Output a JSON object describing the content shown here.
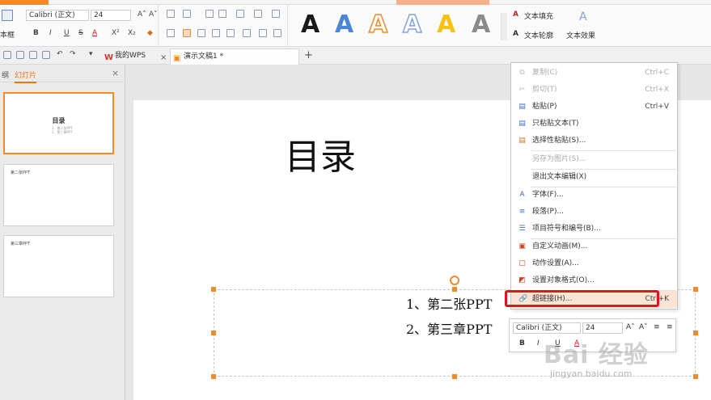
{
  "ribbon": {
    "textbox_label": "本框",
    "font_name": "Calibri (正文)",
    "font_size": "24",
    "bold": "B",
    "italic": "I",
    "underline": "U",
    "strike": "S",
    "font_color": "A",
    "superscript": "X²",
    "subscript": "X₂",
    "text_fill": "文本填充",
    "text_outline": "文本轮廓",
    "text_effect": "文本效果",
    "text_styles": [
      {
        "glyph": "A",
        "color": "#1a1a1a",
        "style": "solid"
      },
      {
        "glyph": "A",
        "color": "#4a86d8",
        "style": "solid"
      },
      {
        "glyph": "A",
        "color": "#f08a2a",
        "style": "outline"
      },
      {
        "glyph": "A",
        "color": "#7ea3dd",
        "style": "outline"
      },
      {
        "glyph": "A",
        "color": "#f6c21a",
        "style": "solid"
      },
      {
        "glyph": "A",
        "color": "#8a8a8a",
        "style": "solid"
      }
    ]
  },
  "tabbar": {
    "wps_tab": "我的WPS",
    "doc_tab": "演示文稿1 *",
    "add_tab": "+"
  },
  "leftpanel": {
    "tab1": "纲",
    "tab2": "幻灯片",
    "close": "×",
    "thumbs": [
      {
        "title": "目录",
        "lines": [
          "1、第二张PPT",
          "2、第三章PPT"
        ]
      },
      {
        "title": "第二张PPT"
      },
      {
        "title": "第三章PPT"
      }
    ]
  },
  "slide": {
    "title": "目录",
    "bullets": [
      "1、第二张PPT",
      "2、第三章PPT"
    ]
  },
  "context_menu": {
    "items": [
      {
        "icon": "copy-icon",
        "glyph": "⧉",
        "label": "复制(C)",
        "shortcut": "Ctrl+C",
        "disabled": true
      },
      {
        "icon": "cut-icon",
        "glyph": "✂",
        "label": "剪切(T)",
        "shortcut": "Ctrl+X",
        "disabled": true
      },
      {
        "icon": "paste-icon",
        "glyph": "▤",
        "label": "粘贴(P)",
        "shortcut": "Ctrl+V",
        "disabled": false
      },
      {
        "icon": "paste-text-icon",
        "glyph": "▤",
        "label": "只粘贴文本(T)",
        "shortcut": "",
        "disabled": false
      },
      {
        "icon": "paste-special-icon",
        "glyph": "▤",
        "label": "选择性粘贴(S)...",
        "shortcut": "",
        "disabled": false
      },
      {
        "icon": "",
        "glyph": "",
        "label": "另存为图片(S)...",
        "shortcut": "",
        "disabled": true
      },
      {
        "icon": "",
        "glyph": "",
        "label": "退出文本编辑(X)",
        "shortcut": "",
        "disabled": false
      },
      {
        "icon": "font-icon",
        "glyph": "A",
        "label": "字体(F)...",
        "shortcut": "",
        "disabled": false
      },
      {
        "icon": "paragraph-icon",
        "glyph": "≡",
        "label": "段落(P)...",
        "shortcut": "",
        "disabled": false
      },
      {
        "icon": "bullets-icon",
        "glyph": "☰",
        "label": "项目符号和编号(B)...",
        "shortcut": "",
        "disabled": false
      },
      {
        "icon": "custom-animation-icon",
        "glyph": "▣",
        "label": "自定义动画(M)...",
        "shortcut": "",
        "disabled": false
      },
      {
        "icon": "action-settings-icon",
        "glyph": "▢",
        "label": "动作设置(A)...",
        "shortcut": "",
        "disabled": false
      },
      {
        "icon": "format-object-icon",
        "glyph": "◩",
        "label": "设置对象格式(O)...",
        "shortcut": "",
        "disabled": false
      },
      {
        "icon": "hyperlink-icon",
        "glyph": "🔗",
        "label": "超链接(H)...",
        "shortcut": "Ctrl+K",
        "disabled": false,
        "highlighted": true
      }
    ]
  },
  "mini_toolbar": {
    "font_name": "Calibri (正文)",
    "font_size": "24",
    "bold": "B",
    "italic": "I",
    "underline": "U",
    "font_color": "A"
  },
  "watermark": {
    "main": "Bai 经验",
    "url": "jingyan.baidu.com"
  }
}
